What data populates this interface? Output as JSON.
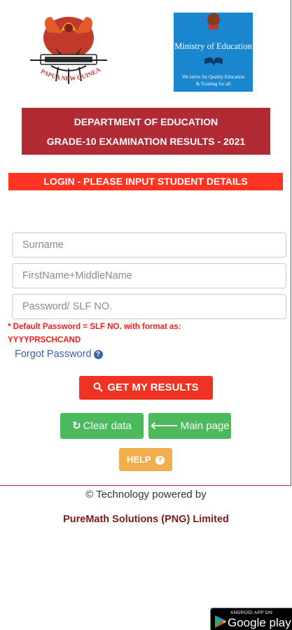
{
  "logos": {
    "png_emblem_text": "PAPUA NEW GUINEA",
    "ministry_title": "Ministry of Education",
    "ministry_motto_line1": "We strive for Quality Education",
    "ministry_motto_line2": "& Training for all"
  },
  "header": {
    "line1": "DEPARTMENT OF EDUCATION",
    "line2": "GRADE-10 EXAMINATION RESULTS - 2021"
  },
  "login_banner": "LOGIN - PLEASE INPUT STUDENT DETAILS",
  "form": {
    "surname_placeholder": "Surname",
    "firstname_placeholder": "FirstName+MiddleName",
    "password_placeholder": "Password/ SLF NO.",
    "hint_line1": "* Default Password = SLF NO. with format as:",
    "hint_line2": "YYYYPRSCHCAND",
    "forgot_label": "Forgot Password"
  },
  "buttons": {
    "get_results": "GET MY RESULTS",
    "clear_data": "Clear data",
    "main_page": "Main page",
    "help": "HELP"
  },
  "footer": {
    "powered_by": "© Technology powered by",
    "company": "PureMath Solutions (PNG) Limited"
  },
  "google_play": {
    "small": "ANDROID APP ON",
    "big": "Google play"
  },
  "colors": {
    "header_bg": "#b12a34",
    "banner_bg": "#ff3322",
    "ministry_bg": "#1a86d0",
    "green_button": "#4cba5c",
    "help_button": "#f2ad4c"
  }
}
